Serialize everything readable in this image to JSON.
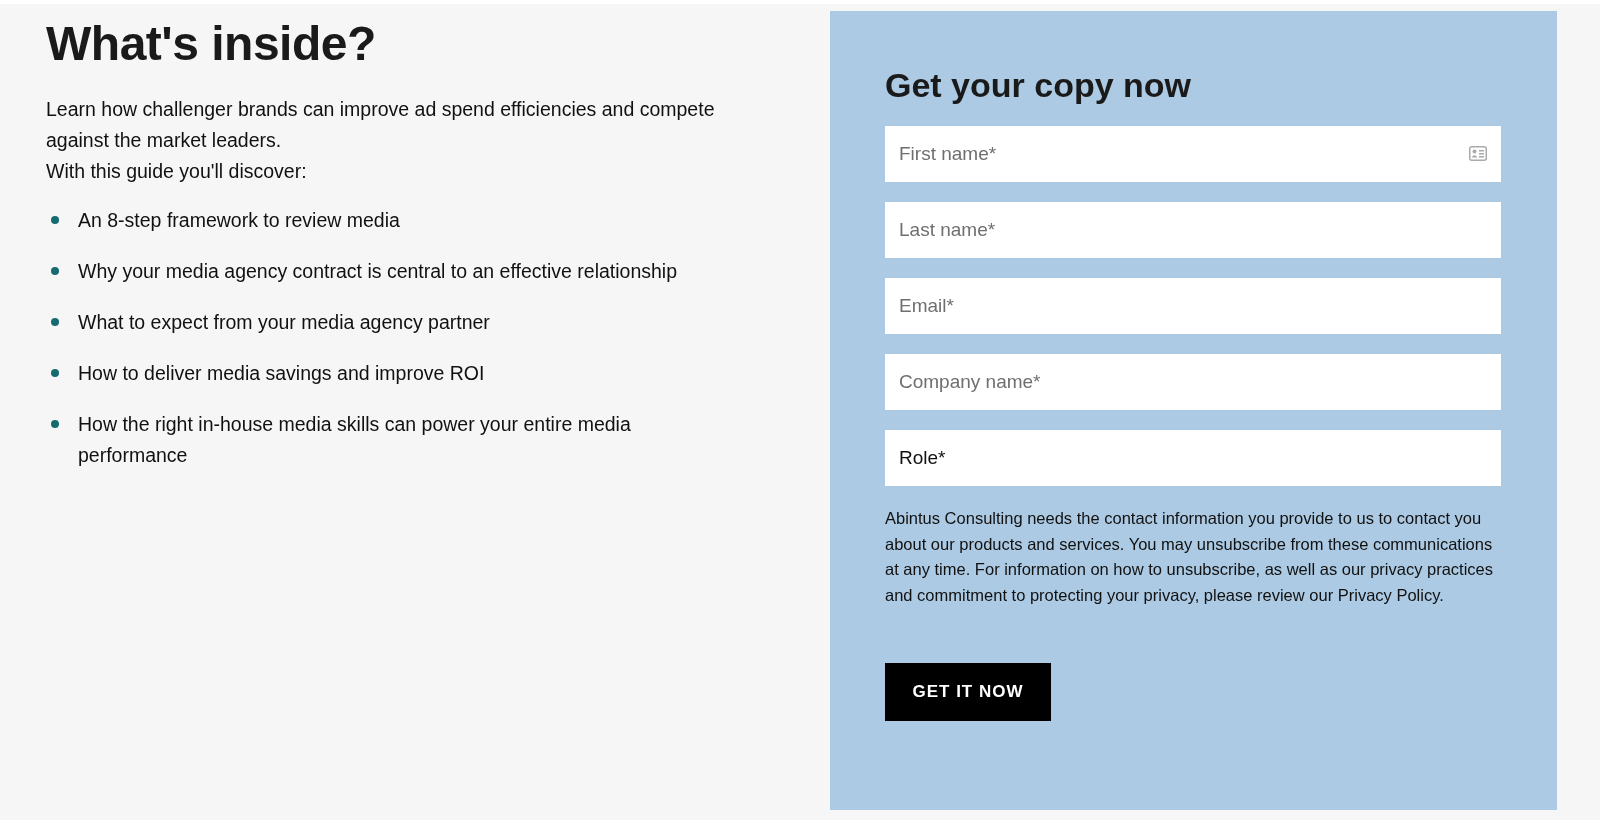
{
  "intro": {
    "title": "What's inside?",
    "paragraphs": [
      "Learn how challenger brands can improve ad spend efficiencies and compete against the market leaders.",
      "With this guide you'll discover:"
    ],
    "bullets": [
      "An 8-step framework to review media",
      "Why your media agency contract is central to an effective relationship",
      "What to expect from your media agency partner",
      "How to deliver media savings and improve ROI",
      "How the right in-house media skills can power your entire media performance"
    ]
  },
  "form": {
    "title": "Get your copy now",
    "fields": [
      {
        "placeholder": "First name*",
        "kind": "contact"
      },
      {
        "placeholder": "Last name*",
        "kind": "text"
      },
      {
        "placeholder": "Email*",
        "kind": "text"
      },
      {
        "placeholder": "Company name*",
        "kind": "text"
      },
      {
        "value": "Role*",
        "kind": "select"
      }
    ],
    "notice": "Abintus Consulting needs the contact information you provide to us to contact you about our products and services. You may unsubscribe from these communications at any time. For information on how to unsubscribe, as well as our privacy practices and commitment to protecting your privacy, please review our Privacy Policy.",
    "submit": "GET IT NOW"
  }
}
